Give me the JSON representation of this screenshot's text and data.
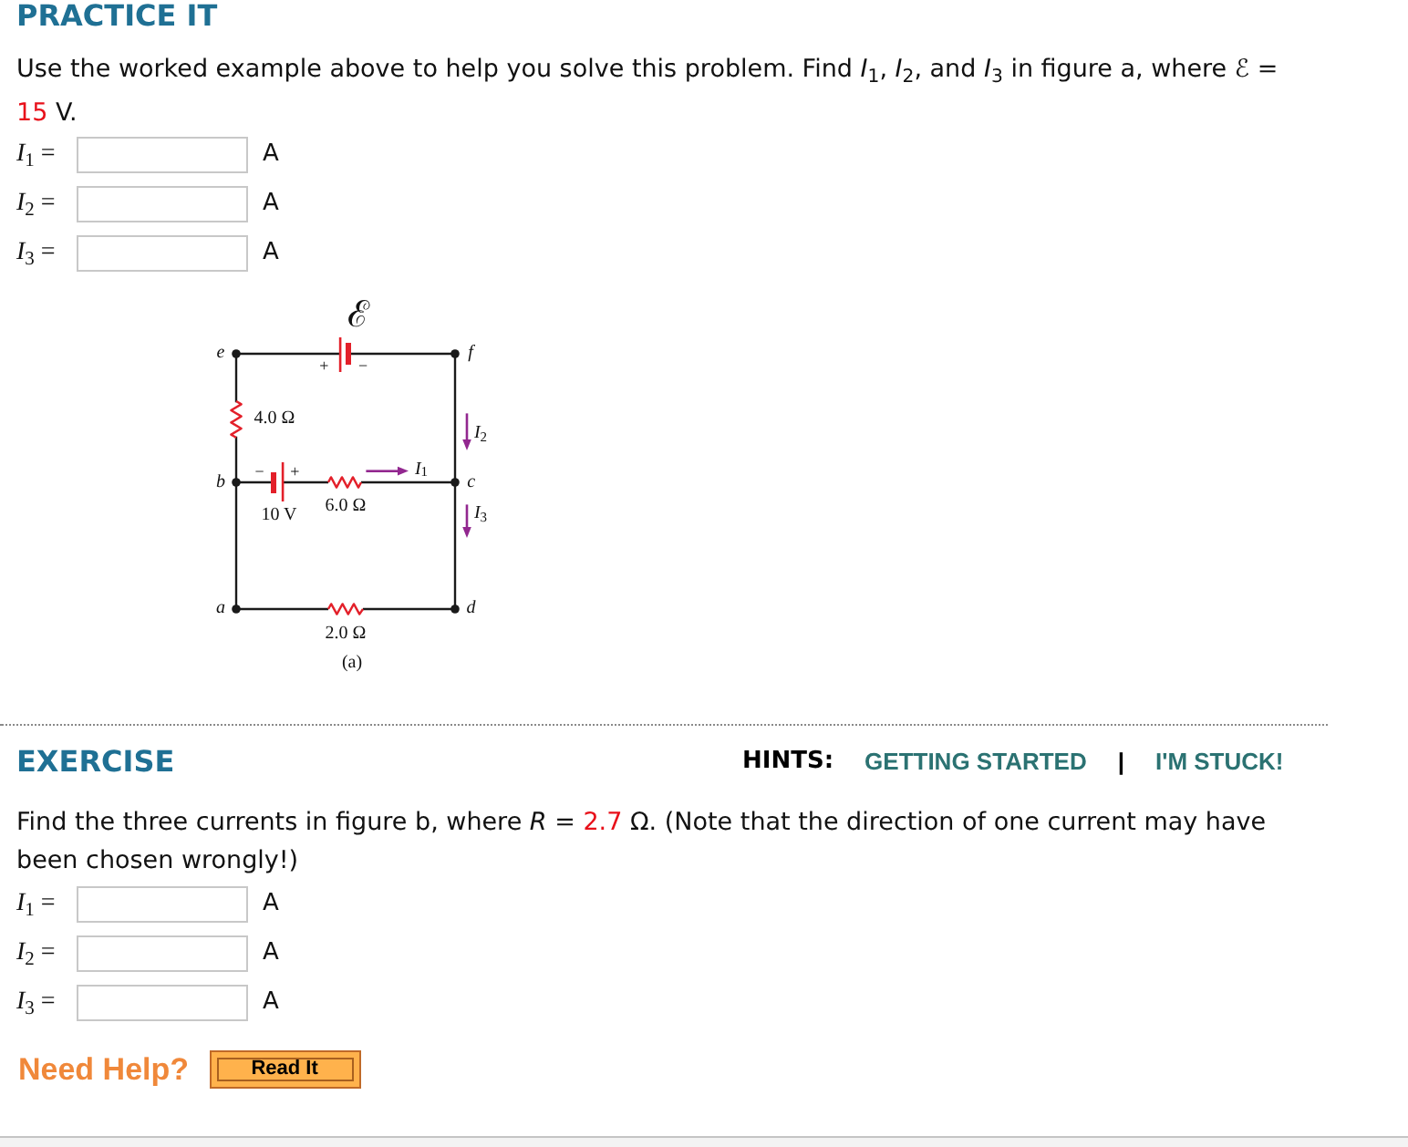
{
  "practice": {
    "title": "PRACTICE IT",
    "prompt": {
      "text": "Use the worked example above to help you solve this problem. Find *I*$_{1}$, *I*$_{2}$, and *I*$_{3}$ in figure a, where ℰ =",
      "value": "15",
      "unit": "V."
    },
    "answers": [
      {
        "label": "*I*$_{1}$ =",
        "unit": "A"
      },
      {
        "label": "*I*$_{2}$ =",
        "unit": "A"
      },
      {
        "label": "*I*$_{3}$ =",
        "unit": "A"
      }
    ],
    "figure": {
      "emf": {
        "symbol": "ℰ",
        "plus": "+",
        "minus": "−"
      },
      "battery": {
        "minus": "−",
        "plus": "+",
        "reading": "10 V"
      },
      "nodes": [
        "e",
        "f",
        "b",
        "c",
        "a",
        "d"
      ],
      "resistors": [
        "4.0 Ω",
        "6.0 Ω",
        "2.0 Ω"
      ],
      "currents": [
        "*I*$_{1}$",
        "*I*$_{2}$",
        "*I*$_{3}$"
      ],
      "caption": "(a)"
    }
  },
  "exercise": {
    "title": "EXERCISE",
    "hints": {
      "label": "HINTS:",
      "links": [
        "GETTING STARTED",
        "I'M STUCK!"
      ],
      "separator": "|"
    },
    "prompt": {
      "before": "Find the three currents in figure b, where *R* =",
      "value": "2.7",
      "after": "Ω. (Note that the direction of one current may have been chosen wrongly!)"
    },
    "answers": [
      {
        "label": "*I*$_{1}$ =",
        "unit": "A"
      },
      {
        "label": "*I*$_{2}$ =",
        "unit": "A"
      },
      {
        "label": "*I*$_{3}$ =",
        "unit": "A"
      }
    ]
  },
  "help": {
    "label": "Need Help?",
    "button": "Read It"
  }
}
